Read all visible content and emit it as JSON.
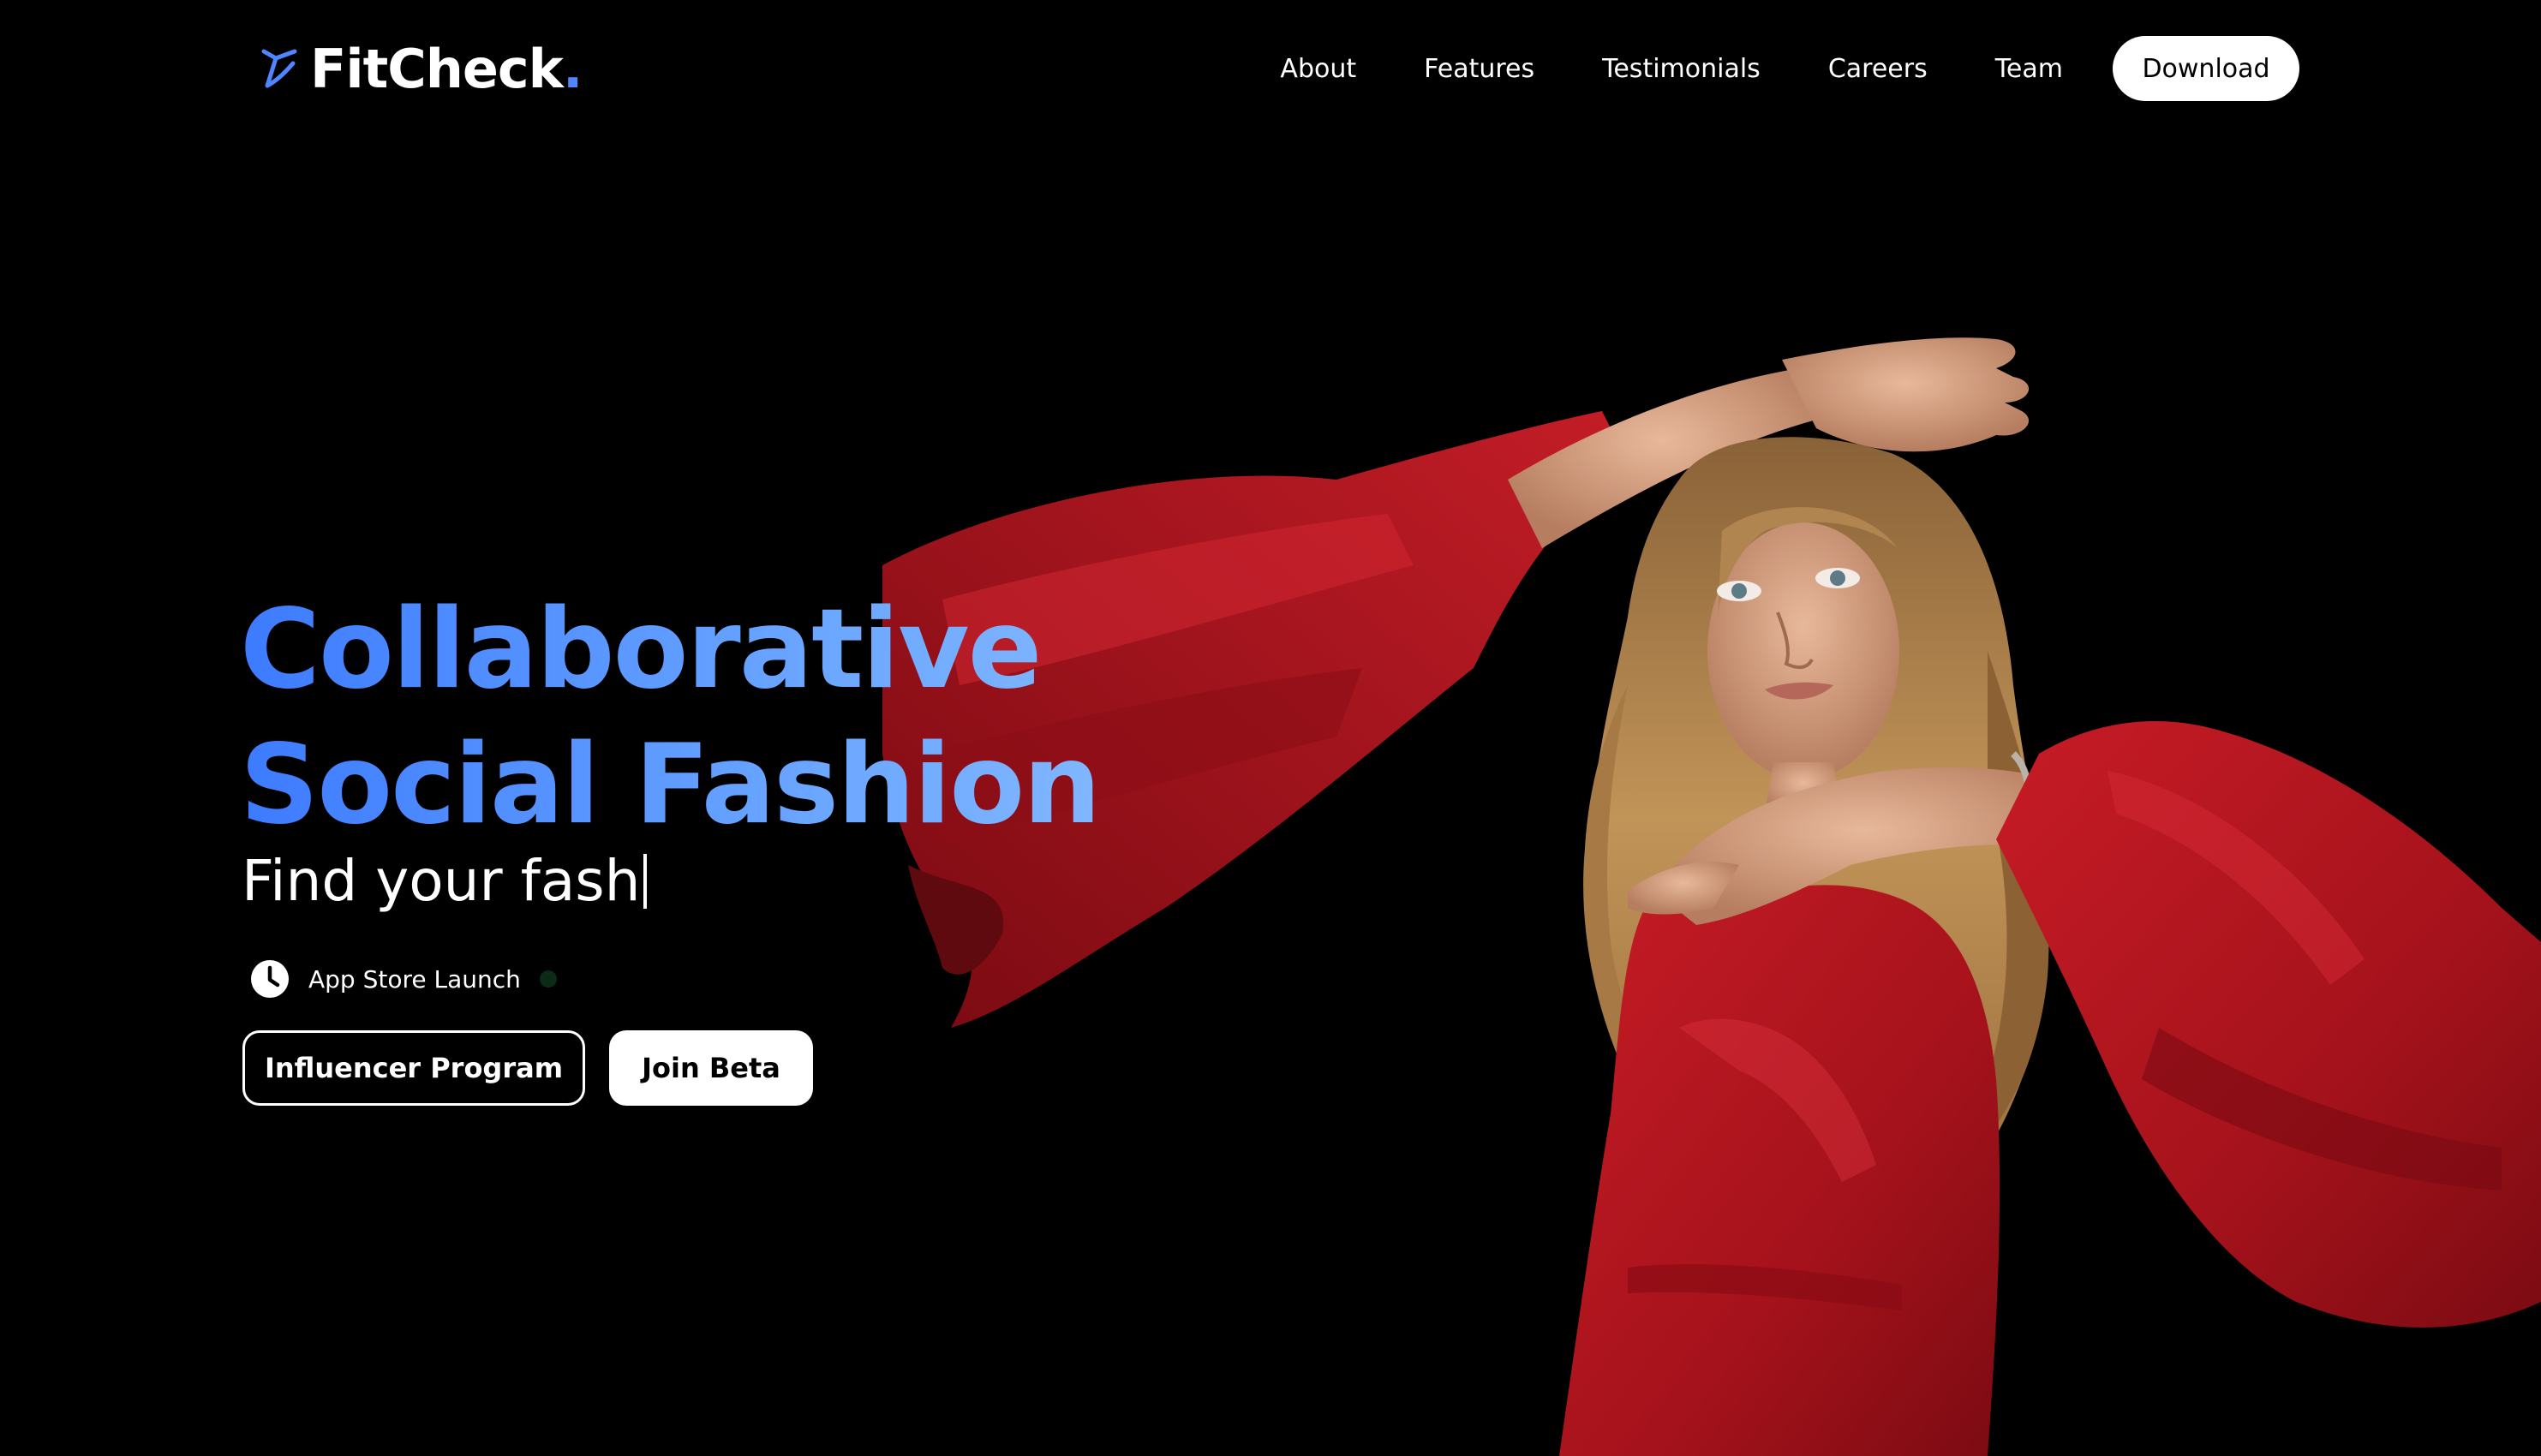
{
  "brand": {
    "name": "FitCheck",
    "dot": ".",
    "accent_color": "#4f86ff",
    "icon": "hanger-icon"
  },
  "nav": {
    "items": [
      {
        "label": "About"
      },
      {
        "label": "Features"
      },
      {
        "label": "Testimonials"
      },
      {
        "label": "Careers"
      },
      {
        "label": "Team"
      }
    ],
    "download_label": "Download"
  },
  "hero": {
    "title_line1": "Collaborative",
    "title_line2": "Social Fashion",
    "gradient_colors": [
      "#3d7bff",
      "#86bbff"
    ],
    "typing_text": "Find your fash",
    "launch_icon": "clock-icon",
    "launch_text": "App Store Launch",
    "status_color": "#0b2a17",
    "buttons": {
      "influencer_label": "Influencer Program",
      "beta_label": "Join Beta"
    },
    "image": {
      "subject": "model-in-red-dress",
      "dress_color": "#b3141e",
      "hair_color": "#b08550",
      "skin_color": "#d9a488"
    }
  }
}
